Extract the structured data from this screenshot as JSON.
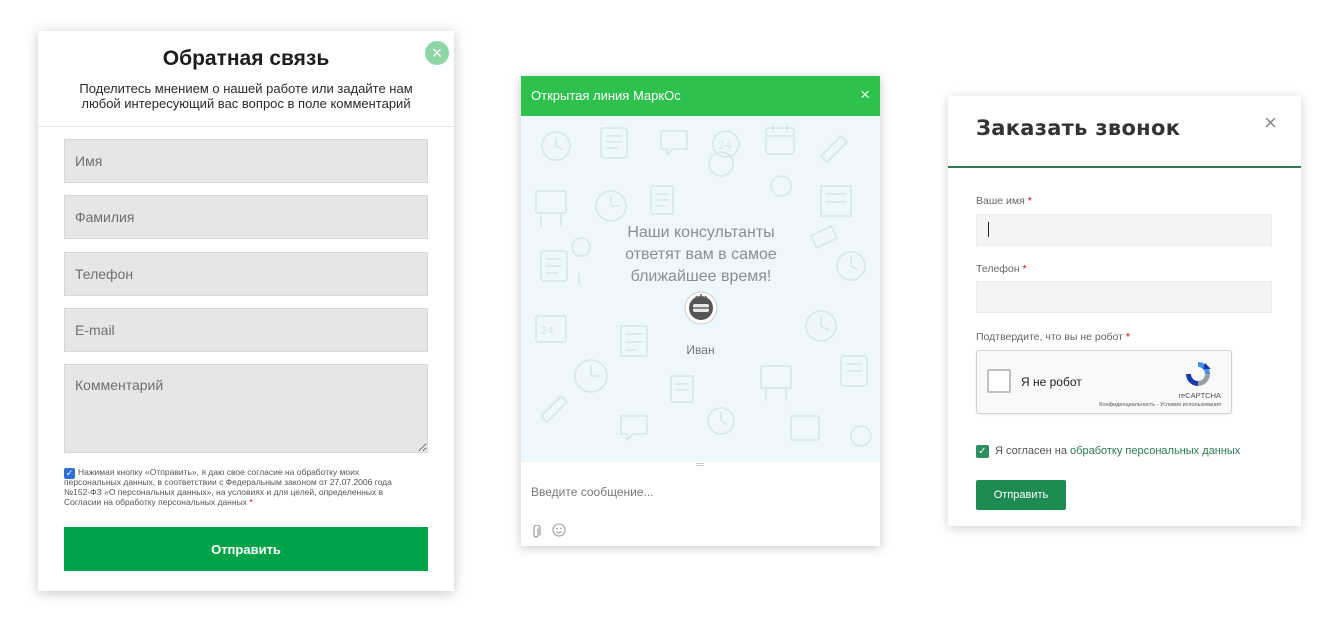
{
  "feedback": {
    "title": "Обратная связь",
    "subtitle": "Поделитесь мнением о нашей работе или задайте нам любой интересующий вас вопрос в поле комментарий",
    "close_icon": "×",
    "fields": {
      "name": "Имя",
      "surname": "Фамилия",
      "phone": "Телефон",
      "email": "E-mail",
      "comment": "Комментарий"
    },
    "consent_text": "Нажимая кнопку «Отправить», я даю свое согласие на обработку моих персональных данных, в соответствии с Федеральным законом от 27.07.2006 года №152-ФЗ «О персональных данных», на условиях и для целей, определенных в Согласии на обработку персональных данных",
    "consent_required": "*",
    "consent_checked": true,
    "submit_label": "Отправить",
    "accent": "#00a348"
  },
  "chat": {
    "title": "Открытая линия МаркОс",
    "close_icon": "×",
    "message": "Наши консультанты ответят вам в самое ближайшее время!",
    "agent_name": "Иван",
    "input_placeholder": "Введите сообщение...",
    "attach_icon": "paperclip-icon",
    "emoji_icon": "smile-icon",
    "header_color": "#2fc14e"
  },
  "callback": {
    "title": "Заказать звонок",
    "close_icon": "×",
    "name_label": "Ваше имя",
    "phone_label": "Телефон",
    "captcha_label": "Подтвердите, что вы не робот",
    "required_mark": "*",
    "recaptcha": {
      "checkbox_text": "Я не робот",
      "brand": "reCAPTCHA",
      "links": "Конфиденциальность - Условия использования"
    },
    "agree_prefix": "Я согласен на ",
    "agree_link": "обработку персональных данных",
    "agree_checked": true,
    "submit_label": "Отправить",
    "accent": "#1e8b52"
  }
}
